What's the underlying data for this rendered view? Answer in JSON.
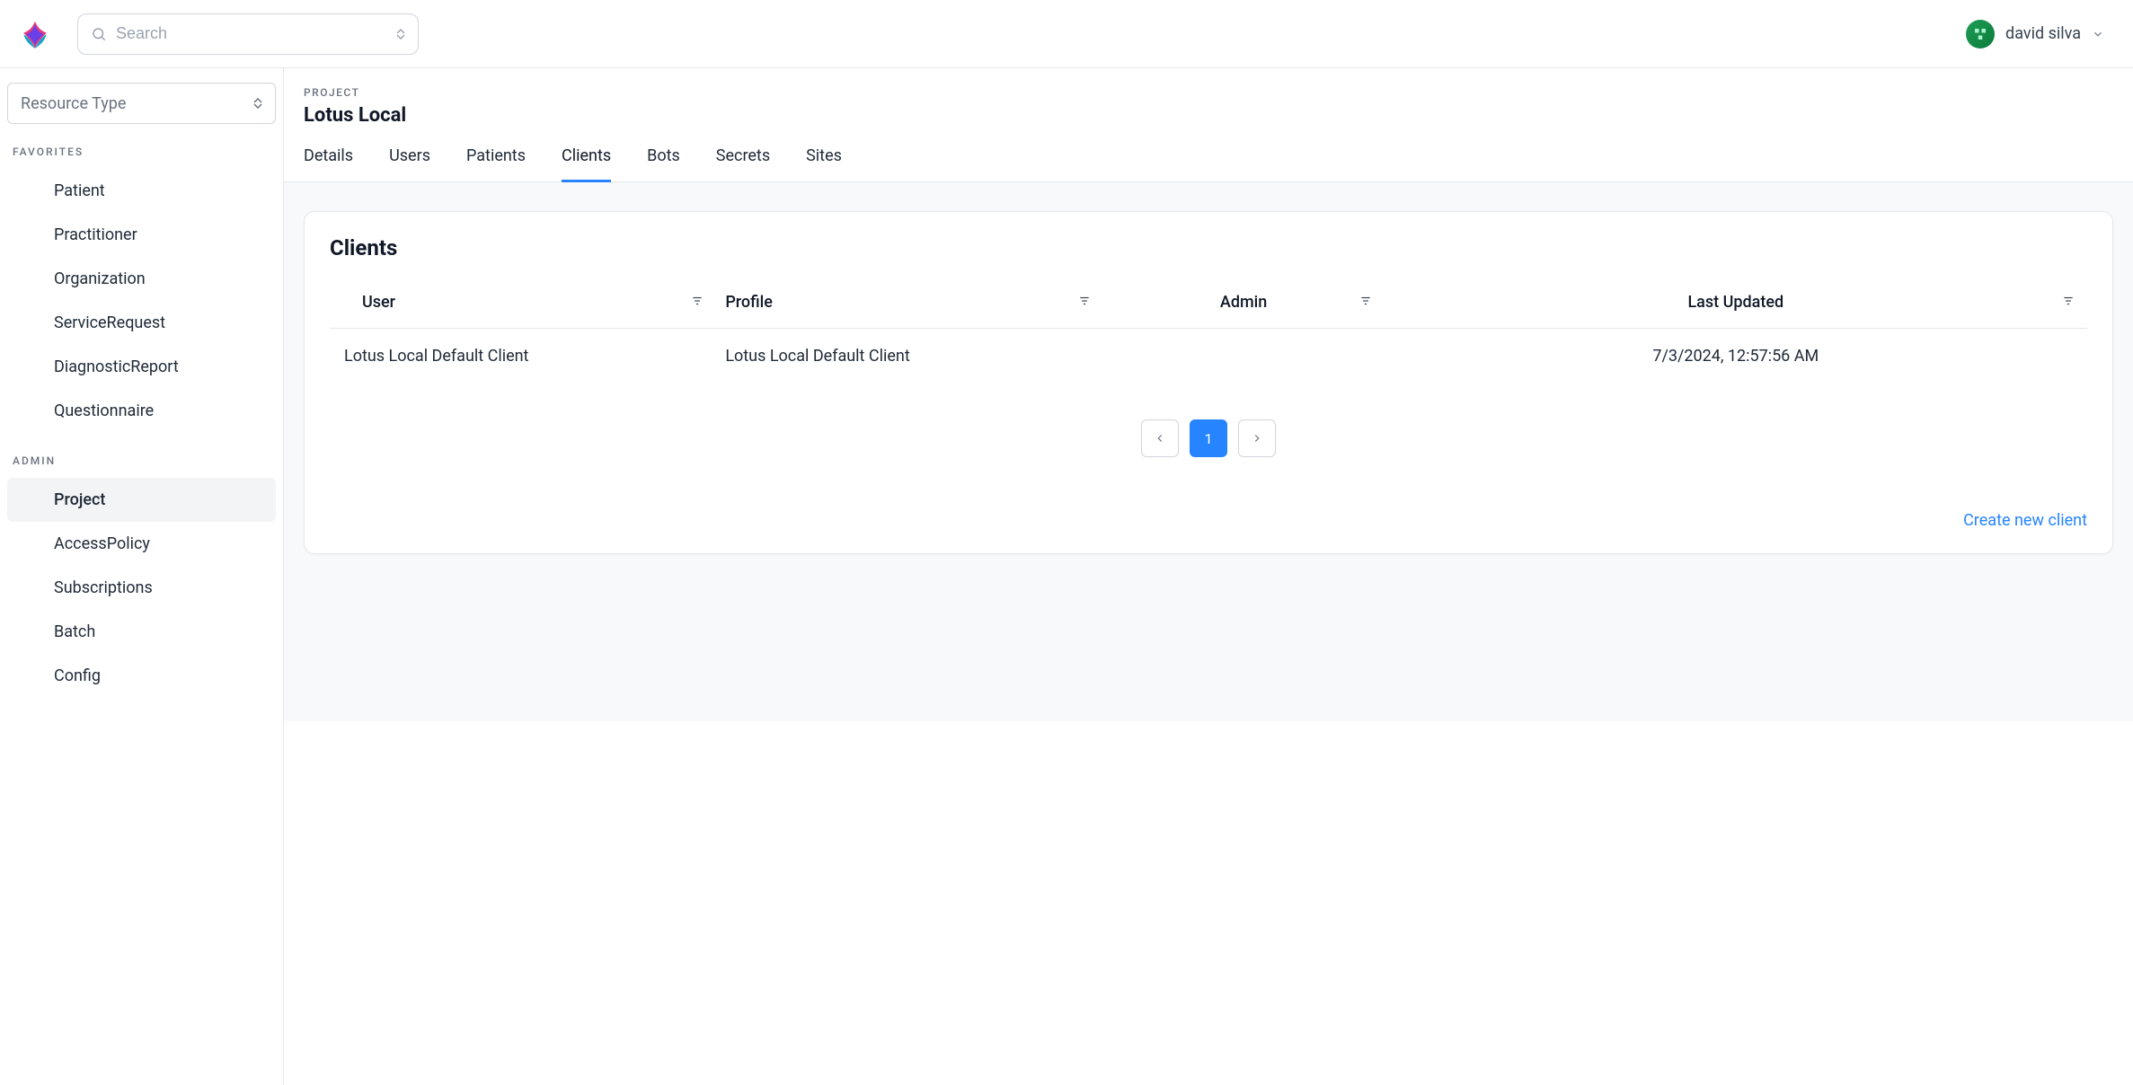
{
  "header": {
    "search_placeholder": "Search",
    "user_name": "david silva"
  },
  "sidebar": {
    "resource_placeholder": "Resource Type",
    "sections": [
      {
        "label": "FAVORITES",
        "items": [
          {
            "label": "Patient",
            "active": false
          },
          {
            "label": "Practitioner",
            "active": false
          },
          {
            "label": "Organization",
            "active": false
          },
          {
            "label": "ServiceRequest",
            "active": false
          },
          {
            "label": "DiagnosticReport",
            "active": false
          },
          {
            "label": "Questionnaire",
            "active": false
          }
        ]
      },
      {
        "label": "ADMIN",
        "items": [
          {
            "label": "Project",
            "active": true
          },
          {
            "label": "AccessPolicy",
            "active": false
          },
          {
            "label": "Subscriptions",
            "active": false
          },
          {
            "label": "Batch",
            "active": false
          },
          {
            "label": "Config",
            "active": false
          }
        ]
      }
    ]
  },
  "page": {
    "eyebrow": "PROJECT",
    "title": "Lotus Local",
    "tabs": [
      {
        "label": "Details",
        "active": false
      },
      {
        "label": "Users",
        "active": false
      },
      {
        "label": "Patients",
        "active": false
      },
      {
        "label": "Clients",
        "active": true
      },
      {
        "label": "Bots",
        "active": false
      },
      {
        "label": "Secrets",
        "active": false
      },
      {
        "label": "Sites",
        "active": false
      }
    ]
  },
  "clients": {
    "title": "Clients",
    "columns": [
      "User",
      "Profile",
      "Admin",
      "Last Updated"
    ],
    "rows": [
      {
        "user": "Lotus Local Default Client",
        "profile": "Lotus Local Default Client",
        "admin": "",
        "last_updated": "7/3/2024, 12:57:56 AM"
      }
    ],
    "pagination": {
      "current": "1"
    },
    "create_label": "Create new client"
  }
}
